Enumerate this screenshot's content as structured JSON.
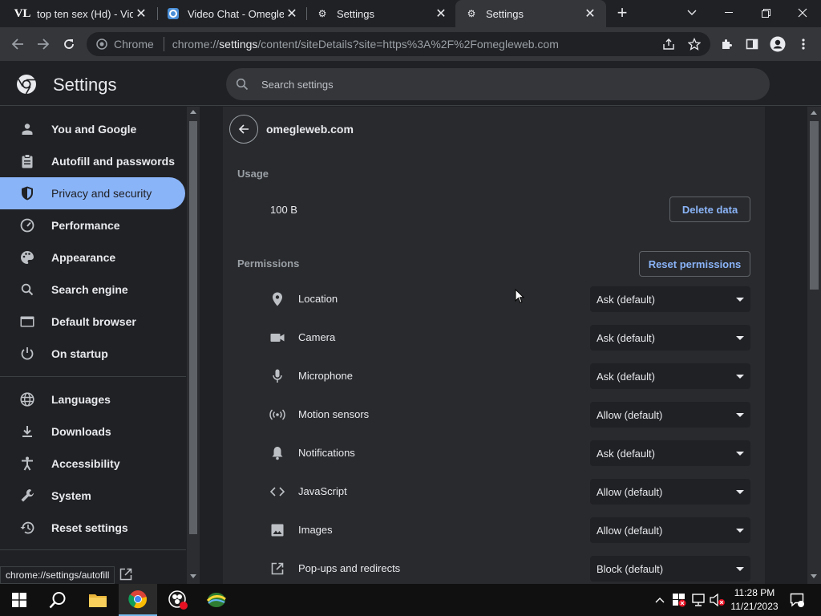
{
  "tabs": [
    {
      "title": "top ten sex (Hd) - VidL",
      "icon": "vidlii-icon"
    },
    {
      "title": "Video Chat - OmegleW",
      "icon": "omegle-icon"
    },
    {
      "title": "Settings",
      "icon": "gear-icon"
    },
    {
      "title": "Settings",
      "icon": "gear-icon",
      "active": true
    }
  ],
  "omnibox": {
    "chip": "Chrome",
    "scheme": "chrome://",
    "host": "settings",
    "path": "/content/siteDetails?site=https%3A%2F%2Fomegleweb.com"
  },
  "settings": {
    "title": "Settings",
    "search_placeholder": "Search settings"
  },
  "sidebar": {
    "items": [
      {
        "label": "You and Google",
        "icon": "person-icon"
      },
      {
        "label": "Autofill and passwords",
        "icon": "clipboard-icon"
      },
      {
        "label": "Privacy and security",
        "icon": "shield-icon",
        "active": true
      },
      {
        "label": "Performance",
        "icon": "speedometer-icon"
      },
      {
        "label": "Appearance",
        "icon": "palette-icon"
      },
      {
        "label": "Search engine",
        "icon": "search-icon"
      },
      {
        "label": "Default browser",
        "icon": "browser-icon"
      },
      {
        "label": "On startup",
        "icon": "power-icon"
      },
      {
        "label": "Languages",
        "icon": "globe-icon"
      },
      {
        "label": "Downloads",
        "icon": "download-icon"
      },
      {
        "label": "Accessibility",
        "icon": "accessibility-icon"
      },
      {
        "label": "System",
        "icon": "wrench-icon"
      },
      {
        "label": "Reset settings",
        "icon": "history-icon"
      }
    ]
  },
  "site": {
    "name": "omegleweb.com",
    "usage_label": "Usage",
    "usage_value": "100 B",
    "delete_label": "Delete data",
    "permissions_label": "Permissions",
    "reset_label": "Reset permissions",
    "permissions": [
      {
        "label": "Location",
        "value": "Ask (default)",
        "icon": "location-pin-icon"
      },
      {
        "label": "Camera",
        "value": "Ask (default)",
        "icon": "camera-icon"
      },
      {
        "label": "Microphone",
        "value": "Ask (default)",
        "icon": "microphone-icon"
      },
      {
        "label": "Motion sensors",
        "value": "Allow (default)",
        "icon": "sensors-icon"
      },
      {
        "label": "Notifications",
        "value": "Ask (default)",
        "icon": "bell-icon"
      },
      {
        "label": "JavaScript",
        "value": "Allow (default)",
        "icon": "code-icon"
      },
      {
        "label": "Images",
        "value": "Allow (default)",
        "icon": "image-icon"
      },
      {
        "label": "Pop-ups and redirects",
        "value": "Block (default)",
        "icon": "open-in-new-icon"
      }
    ]
  },
  "status_tip": "chrome://settings/autofill",
  "clock": {
    "time": "11:28 PM",
    "date": "11/21/2023"
  },
  "colors": {
    "accent": "#8ab4f8",
    "background": "#202124",
    "card": "#292a2d"
  }
}
